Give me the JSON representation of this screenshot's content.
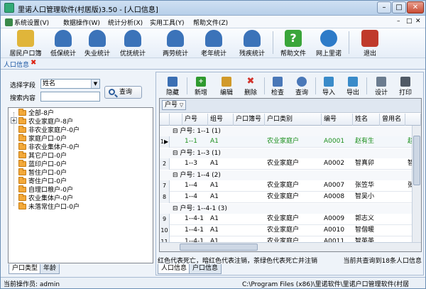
{
  "window": {
    "title": "里诺人口管理软件(村居版)3.50 - [人口信息]",
    "min": "–",
    "max": "□",
    "close": "✕"
  },
  "menubar": [
    {
      "label": "系统设置(V)",
      "color": "#3a8a4a"
    },
    {
      "label": "数据操作(W)",
      "color": ""
    },
    {
      "label": "统计分析(X)",
      "color": ""
    },
    {
      "label": "实用工具(Y)",
      "color": ""
    },
    {
      "label": "帮助文件(Z)",
      "color": ""
    }
  ],
  "mdi_controls": {
    "min": "–",
    "max": "□",
    "close": "✕"
  },
  "toolbar": [
    {
      "label": "居民户口簿",
      "icon": "household-book-icon",
      "color": "#e0b53a"
    },
    {
      "label": "低保统计",
      "icon": "person-icon",
      "color": "#3b73b9"
    },
    {
      "label": "失业统计",
      "icon": "person-icon",
      "color": "#3b73b9"
    },
    {
      "label": "优抚统计",
      "icon": "person-icon",
      "color": "#3b73b9"
    },
    {
      "label": "两劳统计",
      "icon": "person-icon",
      "color": "#3b73b9"
    },
    {
      "label": "老年统计",
      "icon": "person-icon",
      "color": "#3b73b9"
    },
    {
      "label": "残疾统计",
      "icon": "person-icon",
      "color": "#3b73b9"
    },
    {
      "label": "帮助文件",
      "icon": "help-icon",
      "color": "#3aa53a"
    },
    {
      "label": "网上里诺",
      "icon": "globe-icon",
      "color": "#2d7bc8"
    },
    {
      "label": "退出",
      "icon": "exit-door-icon",
      "color": "#c03a2b"
    }
  ],
  "doc_tab": {
    "label": "人口信息",
    "close": "✖"
  },
  "search": {
    "field_label": "选择字段",
    "field_value": "姓名",
    "content_label": "搜索内容",
    "content_value": "",
    "query_button": "查询"
  },
  "tree": [
    "全部-8户",
    "农业家庭户-8户",
    "非农业家庭户-0户",
    "家庭户口-0户",
    "非农业集体户-0户",
    "其它户口-0户",
    "蓝印户口-0户",
    "暂住户口-0户",
    "寄住户口-0户",
    "自理口粮户-0户",
    "农业集体户-0户",
    "未落常住户口-0户"
  ],
  "left_tabs": [
    "户口类型",
    "年龄"
  ],
  "grid_toolbar": [
    {
      "label": "隐藏",
      "icon": "hide-icon",
      "color": "#3b6fb3"
    },
    {
      "label": "新增",
      "icon": "add-icon",
      "color": "#2f9a2f"
    },
    {
      "label": "编辑",
      "icon": "edit-icon",
      "color": "#d19a2a"
    },
    {
      "label": "删除",
      "icon": "delete-icon",
      "color": "#d2332b"
    },
    {
      "label": "检查",
      "icon": "check-icon",
      "color": "#4a78b8"
    },
    {
      "label": "查询",
      "icon": "search-icon",
      "color": "#4a78b8"
    },
    {
      "label": "导入",
      "icon": "import-icon",
      "color": "#3a8bc9"
    },
    {
      "label": "导出",
      "icon": "export-icon",
      "color": "#3a8bc9"
    },
    {
      "label": "设计",
      "icon": "design-icon",
      "color": "#6b7c8f"
    },
    {
      "label": "打印",
      "icon": "print-icon",
      "color": "#505a66"
    }
  ],
  "group_chip": "户号",
  "columns": [
    "户号",
    "组号",
    "户口簿号",
    "户口类别",
    "编号",
    "姓名",
    "曾用名"
  ],
  "groups": [
    {
      "header": "户号: 1--1 (1)",
      "rows": [
        {
          "rownum": "1",
          "current": true,
          "cells": [
            "1--1",
            "A1",
            "",
            "农业家庭户",
            "A0001",
            "赵有生",
            ""
          ],
          "green": true
        }
      ]
    },
    {
      "header": "户号: 1--3 (1)",
      "rows": [
        {
          "rownum": "2",
          "current": false,
          "cells": [
            "1--3",
            "A1",
            "",
            "农业家庭户",
            "A0002",
            "智真卯",
            ""
          ],
          "green": false
        }
      ]
    },
    {
      "header": "户号: 1--4 (2)",
      "rows": [
        {
          "rownum": "7",
          "current": false,
          "cells": [
            "1--4",
            "A1",
            "",
            "农业家庭户",
            "A0007",
            "张笠华",
            ""
          ],
          "green": false
        },
        {
          "rownum": "8",
          "current": false,
          "cells": [
            "1--4",
            "A1",
            "",
            "农业家庭户",
            "A0008",
            "智吴小",
            ""
          ],
          "green": false
        }
      ]
    },
    {
      "header": "户号: 1--4-1 (3)",
      "rows": [
        {
          "rownum": "9",
          "current": false,
          "cells": [
            "1--4-1",
            "A1",
            "",
            "农业家庭户",
            "A0009",
            "郭志义",
            ""
          ],
          "green": false
        },
        {
          "rownum": "10",
          "current": false,
          "cells": [
            "1--4-1",
            "A1",
            "",
            "农业家庭户",
            "A0010",
            "智偕暖",
            ""
          ],
          "green": false
        },
        {
          "rownum": "11",
          "current": false,
          "cells": [
            "1--4-1",
            "A1",
            "",
            "农业家庭户",
            "A0011",
            "智英英",
            ""
          ],
          "green": false
        }
      ]
    }
  ],
  "partial_last_col": [
    "赵",
    "智",
    "张"
  ],
  "legend": "红色代表死亡，暗红色代表注销，茶绿色代表死亡并注销",
  "query_result": "当前共查询到18条人口信息",
  "right_tabs": [
    "人口信息",
    "户口信息"
  ],
  "status": {
    "operator": "当前操作员: admin",
    "path": "C:\\Program Files (x86)\\里诺软件\\里诺户口管理软件(村居"
  }
}
